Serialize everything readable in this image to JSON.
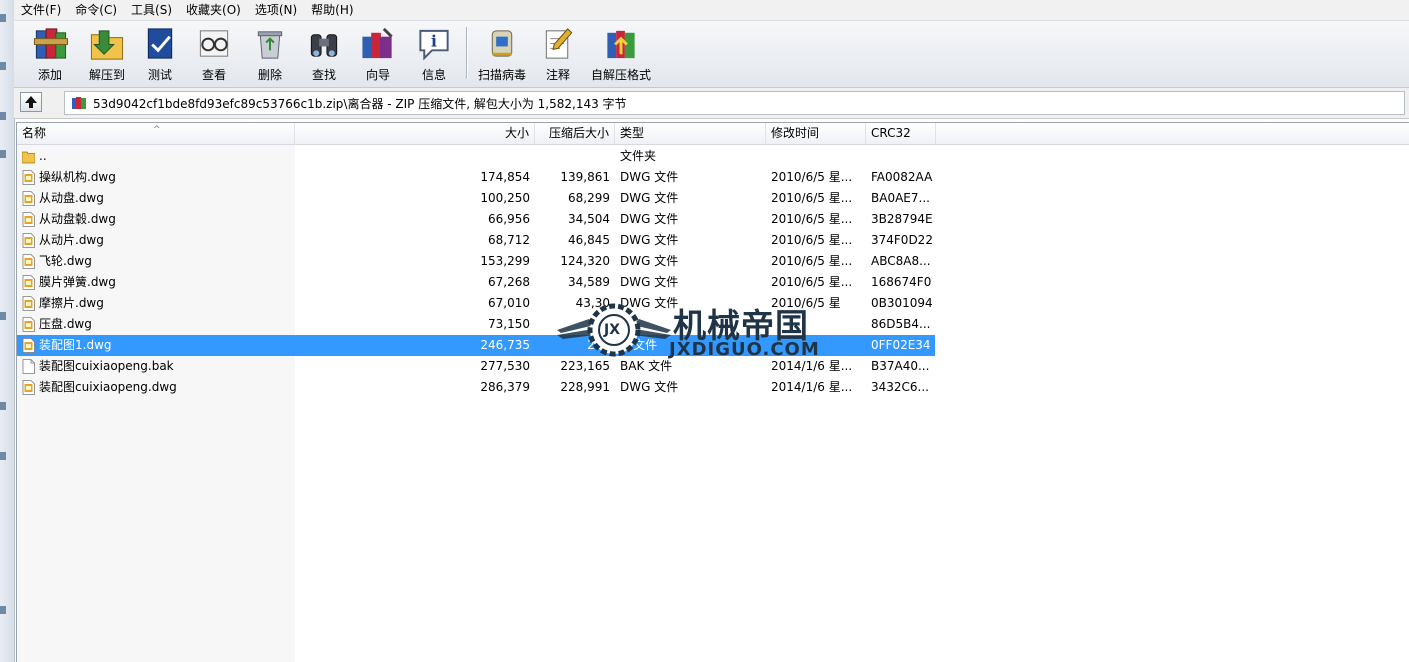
{
  "menu": [
    "文件(F)",
    "命令(C)",
    "工具(S)",
    "收藏夹(O)",
    "选项(N)",
    "帮助(H)"
  ],
  "toolbar": {
    "add": "添加",
    "extract_to": "解压到",
    "test": "测试",
    "view": "查看",
    "delete": "删除",
    "find": "查找",
    "wizard": "向导",
    "info": "信息",
    "scan_virus": "扫描病毒",
    "comment": "注释",
    "sfx": "自解压格式"
  },
  "path": "53d9042cf1bde8fd93efc89c53766c1b.zip\\离合器 - ZIP 压缩文件, 解包大小为 1,582,143 字节",
  "columns": {
    "name": "名称",
    "size": "大小",
    "packed": "压缩后大小",
    "type": "类型",
    "modified": "修改时间",
    "crc": "CRC32"
  },
  "files": [
    {
      "name": "..",
      "size": "",
      "packed": "",
      "type": "文件夹",
      "modified": "",
      "crc": "",
      "icon": "folder-icon"
    },
    {
      "name": "操纵机构.dwg",
      "size": "174,854",
      "packed": "139,861",
      "type": "DWG 文件",
      "modified": "2010/6/5 星...",
      "crc": "FA0082AA",
      "icon": "dwg-file-icon"
    },
    {
      "name": "从动盘.dwg",
      "size": "100,250",
      "packed": "68,299",
      "type": "DWG 文件",
      "modified": "2010/6/5 星...",
      "crc": "BA0AE7...",
      "icon": "dwg-file-icon"
    },
    {
      "name": "从动盘毂.dwg",
      "size": "66,956",
      "packed": "34,504",
      "type": "DWG 文件",
      "modified": "2010/6/5 星...",
      "crc": "3B28794E",
      "icon": "dwg-file-icon"
    },
    {
      "name": "从动片.dwg",
      "size": "68,712",
      "packed": "46,845",
      "type": "DWG 文件",
      "modified": "2010/6/5 星...",
      "crc": "374F0D22",
      "icon": "dwg-file-icon"
    },
    {
      "name": "飞轮.dwg",
      "size": "153,299",
      "packed": "124,320",
      "type": "DWG 文件",
      "modified": "2010/6/5 星...",
      "crc": "ABC8A8...",
      "icon": "dwg-file-icon"
    },
    {
      "name": "膜片弹簧.dwg",
      "size": "67,268",
      "packed": "34,589",
      "type": "DWG 文件",
      "modified": "2010/6/5 星...",
      "crc": "168674F0",
      "icon": "dwg-file-icon"
    },
    {
      "name": "摩擦片.dwg",
      "size": "67,010",
      "packed": "43,30",
      "type": "DWG 文件",
      "modified": "2010/6/5 星",
      "crc": "0B301094",
      "icon": "dwg-file-icon"
    },
    {
      "name": "压盘.dwg",
      "size": "73,150",
      "packed": "",
      "type": "文",
      "modified": "",
      "crc": "86D5B4...",
      "icon": "dwg-file-icon"
    },
    {
      "name": "装配图1.dwg",
      "size": "246,735",
      "packed": "209",
      "type": "G 文件",
      "modified": "",
      "crc": "0FF02E34",
      "icon": "dwg-file-icon",
      "selected": true
    },
    {
      "name": "装配图cuixiaopeng.bak",
      "size": "277,530",
      "packed": "223,165",
      "type": "BAK 文件",
      "modified": "2014/1/6 星...",
      "crc": "B37A40...",
      "icon": "generic-file-icon"
    },
    {
      "name": "装配图cuixiaopeng.dwg",
      "size": "286,379",
      "packed": "228,991",
      "type": "DWG 文件",
      "modified": "2014/1/6 星...",
      "crc": "3432C6...",
      "icon": "dwg-file-icon"
    }
  ],
  "watermark": {
    "title": "机械帝国",
    "site": "JXDIGUO.COM",
    "badge": "JX"
  },
  "colors": {
    "selection": "#3399ff",
    "toolbar_bg": "#e3e7ed",
    "watermark": "#1f3447"
  }
}
